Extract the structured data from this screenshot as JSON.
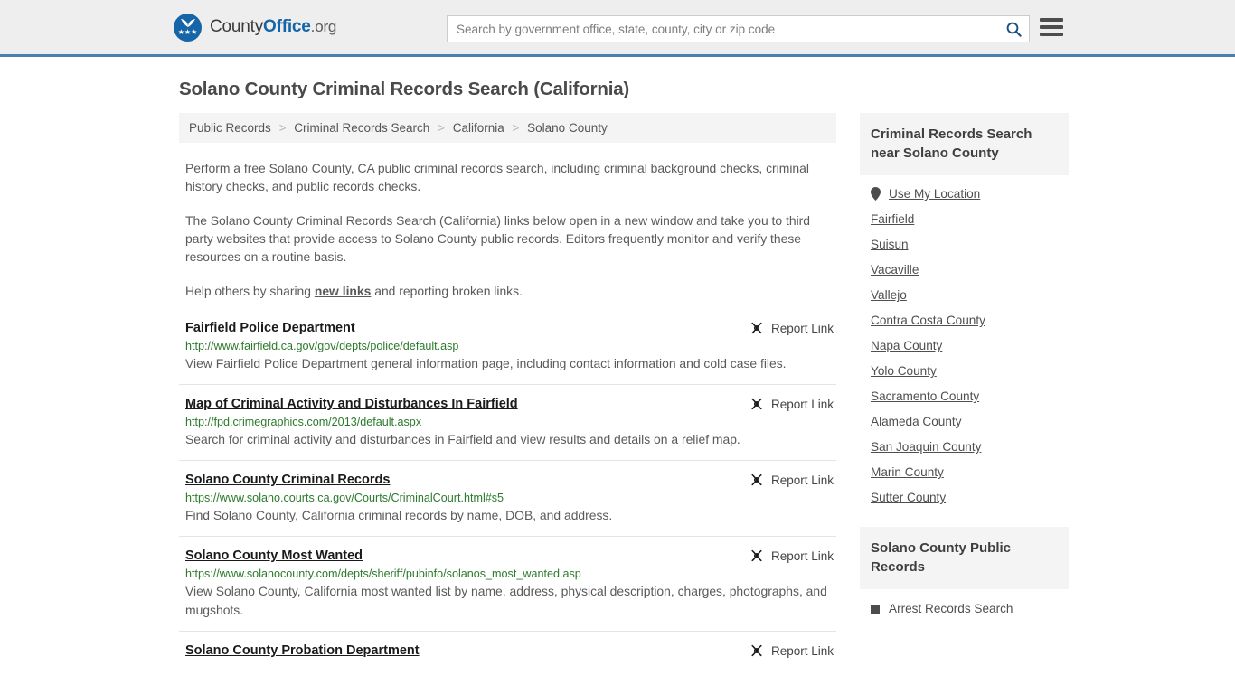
{
  "header": {
    "logo": {
      "text_part1": "County",
      "text_part2": "Office",
      "text_part3": ".org",
      "stars": "★★★"
    },
    "search": {
      "placeholder": "Search by government office, state, county, city or zip code",
      "value": "",
      "icon": "search-icon"
    },
    "menu_icon": "hamburger-menu-icon"
  },
  "page": {
    "title": "Solano County Criminal Records Search (California)"
  },
  "breadcrumb": {
    "separator": ">",
    "items": [
      {
        "label": "Public Records"
      },
      {
        "label": "Criminal Records Search"
      },
      {
        "label": "California"
      },
      {
        "label": "Solano County"
      }
    ]
  },
  "intro": {
    "paragraph1": "Perform a free Solano County, CA public criminal records search, including criminal background checks, criminal history checks, and public records checks.",
    "paragraph2": "The Solano County Criminal Records Search (California) links below open in a new window and take you to third party websites that provide access to Solano County public records. Editors frequently monitor and verify these resources on a routine basis.",
    "paragraph3_before": "Help others by sharing ",
    "paragraph3_link": "new links",
    "paragraph3_after": " and reporting broken links."
  },
  "results": {
    "report_label": "Report Link",
    "report_icon": "broken-link-icon",
    "items": [
      {
        "title": "Fairfield Police Department",
        "url": "http://www.fairfield.ca.gov/gov/depts/police/default.asp",
        "description": "View Fairfield Police Department general information page, including contact information and cold case files."
      },
      {
        "title": "Map of Criminal Activity and Disturbances In Fairfield",
        "url": "http://fpd.crimegraphics.com/2013/default.aspx",
        "description": "Search for criminal activity and disturbances in Fairfield and view results and details on a relief map."
      },
      {
        "title": "Solano County Criminal Records",
        "url": "https://www.solano.courts.ca.gov/Courts/CriminalCourt.html#s5",
        "description": "Find Solano County, California criminal records by name, DOB, and address."
      },
      {
        "title": "Solano County Most Wanted",
        "url": "https://www.solanocounty.com/depts/sheriff/pubinfo/solanos_most_wanted.asp",
        "description": "View Solano County, California most wanted list by name, address, physical description, charges, photographs, and mugshots."
      },
      {
        "title": "Solano County Probation Department",
        "url": "",
        "description": ""
      }
    ]
  },
  "sidebar": {
    "panel1": {
      "heading": "Criminal Records Search near Solano County",
      "use_my_location": {
        "label": "Use My Location",
        "icon": "map-pin-icon"
      },
      "links": [
        {
          "label": "Fairfield"
        },
        {
          "label": "Suisun"
        },
        {
          "label": "Vacaville"
        },
        {
          "label": "Vallejo"
        },
        {
          "label": "Contra Costa County"
        },
        {
          "label": "Napa County"
        },
        {
          "label": "Yolo County"
        },
        {
          "label": "Sacramento County"
        },
        {
          "label": "Alameda County"
        },
        {
          "label": "San Joaquin County"
        },
        {
          "label": "Marin County"
        },
        {
          "label": "Sutter County"
        }
      ]
    },
    "panel2": {
      "heading": "Solano County Public Records",
      "links": [
        {
          "label": "Arrest Records Search"
        }
      ]
    }
  },
  "colors": {
    "brand_blue": "#1565a8",
    "header_border": "#4a7fae",
    "url_green": "#2b7a2b",
    "panel_bg": "#f4f4f4"
  }
}
